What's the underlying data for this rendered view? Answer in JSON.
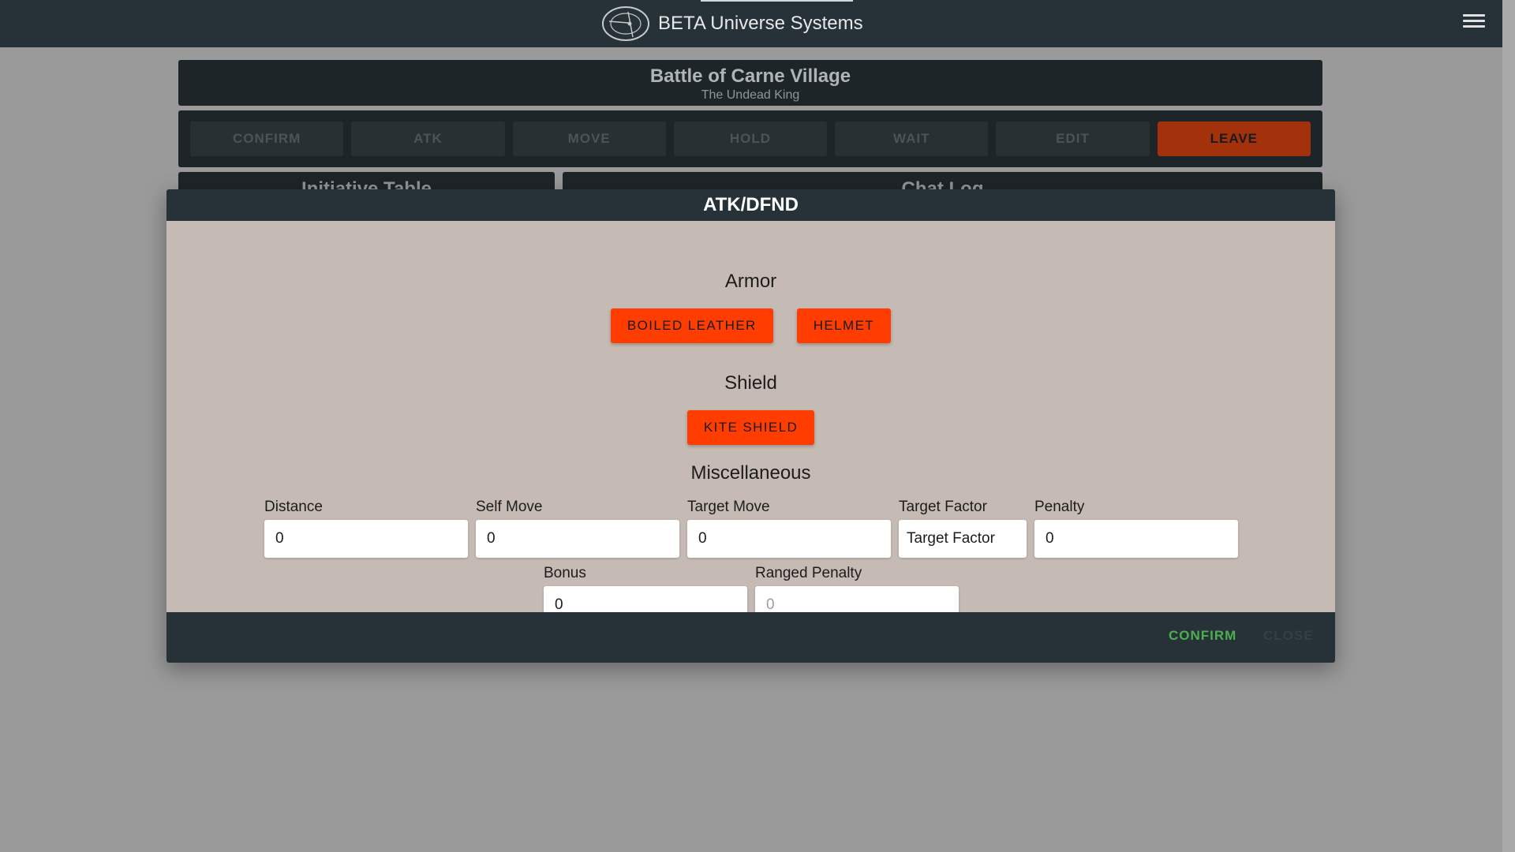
{
  "app": {
    "title": "BETA Universe Systems"
  },
  "battle": {
    "title": "Battle of Carne Village",
    "subtitle": "The Undead King",
    "actions": [
      "CONFIRM",
      "ATK",
      "MOVE",
      "HOLD",
      "WAIT",
      "EDIT",
      "LEAVE"
    ],
    "panels": {
      "left": "Initiative Table",
      "right": "Chat Log"
    }
  },
  "modal": {
    "title": "ATK/DFND",
    "armor": {
      "heading": "Armor",
      "items": [
        "BOILED LEATHER",
        "HELMET"
      ]
    },
    "shield": {
      "heading": "Shield",
      "items": [
        "KITE SHIELD"
      ]
    },
    "misc": {
      "heading": "Miscellaneous",
      "fields": {
        "distance": {
          "label": "Distance",
          "value": "0"
        },
        "self_move": {
          "label": "Self Move",
          "value": "0"
        },
        "target_move": {
          "label": "Target Move",
          "value": "0"
        },
        "target_factor": {
          "label": "Target Factor",
          "value": "Target Factor"
        },
        "penalty": {
          "label": "Penalty",
          "value": "0"
        },
        "bonus": {
          "label": "Bonus",
          "value": "0"
        },
        "ranged_penalty": {
          "label": "Ranged Penalty",
          "value": "0"
        }
      }
    },
    "footer": {
      "confirm": "CONFIRM",
      "close": "CLOSE"
    }
  },
  "colors": {
    "accent": "#ff3d00",
    "leave": "#a3320c",
    "topbar": "#263238",
    "modal_body": "#c6bbb4",
    "confirm": "#4caf50",
    "overlay": "#9a9a9a"
  },
  "icons": {
    "logo": "beta-universe-logo",
    "menu": "hamburger-menu-icon"
  }
}
